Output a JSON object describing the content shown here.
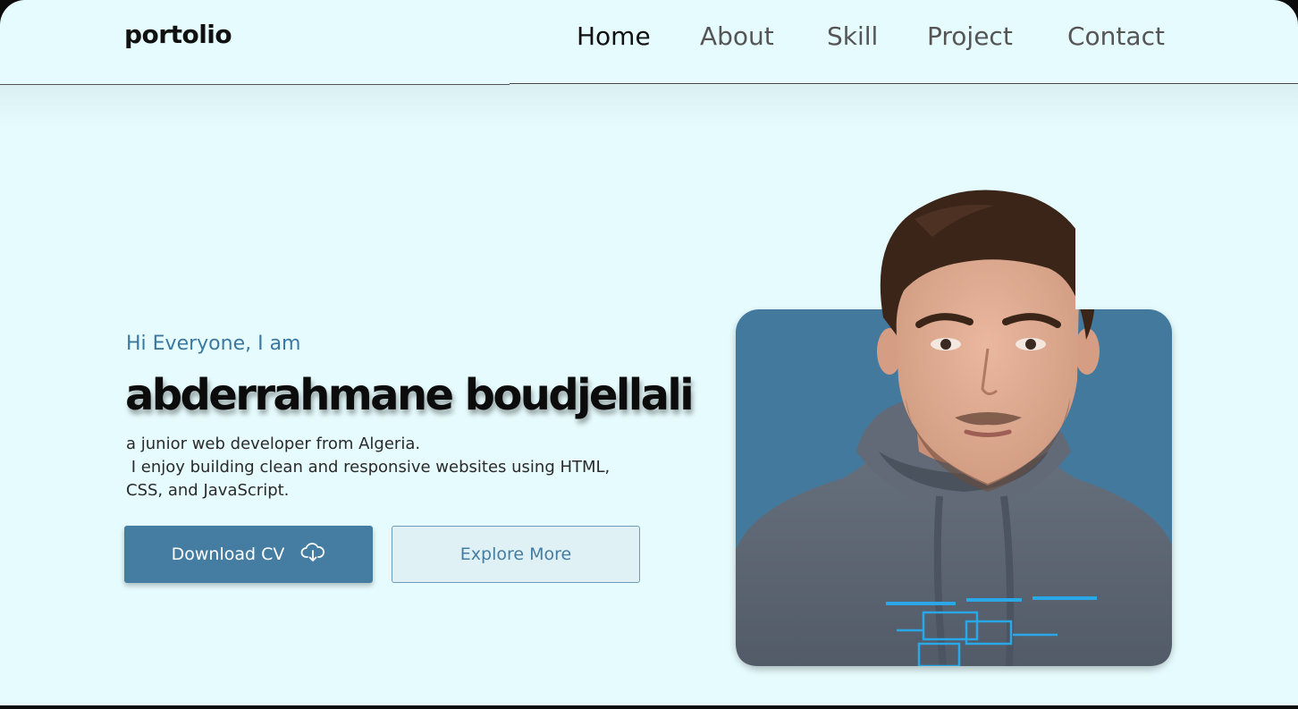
{
  "header": {
    "logo": "portolio",
    "nav": [
      {
        "label": "Home",
        "active": true
      },
      {
        "label": "About",
        "active": false
      },
      {
        "label": "Skill",
        "active": false
      },
      {
        "label": "Project",
        "active": false
      },
      {
        "label": "Contact",
        "active": false
      }
    ]
  },
  "hero": {
    "greeting": "Hi Everyone, I am",
    "name": "abderrahmane boudjellali",
    "bio_lines": [
      "a junior web developer from Algeria.",
      " I enjoy building clean and responsive websites using HTML,",
      "CSS, and JavaScript."
    ],
    "download_label": "Download CV",
    "download_icon": "cloud-download-icon",
    "explore_label": "Explore More"
  },
  "colors": {
    "background": "#e6fbfd",
    "accent": "#457ca2",
    "greeting": "#3b78a0",
    "card": "#44799e",
    "hoodie": "#5d6672",
    "skin": "#e0ad93",
    "hair": "#3b2519"
  }
}
